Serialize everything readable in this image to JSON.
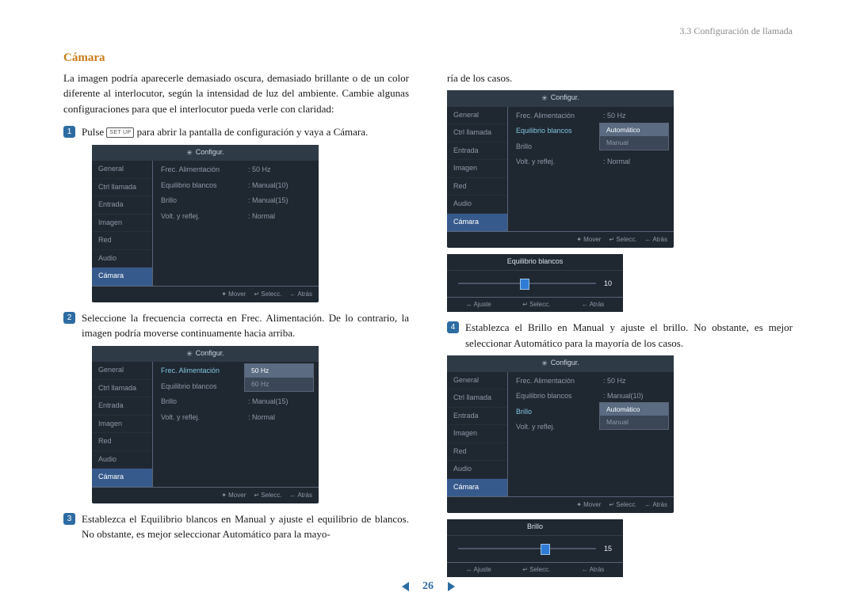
{
  "breadcrumb": "3.3 Configuración de llamada",
  "heading": "Cámara",
  "intro": "La imagen podría aparecerle demasiado oscura, demasiado brillante o de un color diferente al interlocutor, según la intensidad de luz del ambiente. Cambie algunas configuraciones para que el interlocutor pueda verle con claridad:",
  "step1_pre": "Pulse ",
  "setup_key": "SET UP",
  "step1_post": " para abrir la pantalla de configuración y vaya a Cámara.",
  "step2": "Seleccione la frecuencia correcta en Frec. Alimentación. De lo contrario, la imagen podría moverse continuamente hacia arriba.",
  "step3": "Establezca el Equilibrio blancos en Manual y ajuste el equilibrio de blancos. No obstante, es mejor seleccionar Automático para la mayo-",
  "col2_cont": "ría de los casos.",
  "step4": "Establezca el Brillo en Manual y ajuste el brillo. No obstante, es mejor seleccionar Automático para la mayoría de los casos.",
  "panel_title": "Configur.",
  "sidebar_items": [
    "General",
    "Ctrl llamada",
    "Entrada",
    "Imagen",
    "Red",
    "Audio",
    "Cámara"
  ],
  "rows_frec": {
    "lab": "Frec. Alimentación",
    "val": ": 50 Hz"
  },
  "rows_eq": "Equilibrio blancos",
  "rows_brillo": "Brillo",
  "rows_volt": "Volt. y reflej.",
  "val_manual10": ": Manual(10)",
  "val_manual15": ": Manual(15)",
  "val_normal": ": Normal",
  "opt_50": "50 Hz",
  "opt_60": "60 Hz",
  "opt_auto": "Automático",
  "opt_manual": "Manual",
  "footer_mover": "✦ Mover",
  "footer_selec": "↵ Selecc.",
  "footer_atras": "← Atrás",
  "slider_eq_title": "Equilibrio blancos",
  "slider_eq_value": "10",
  "slider_brillo_title": "Brillo",
  "slider_brillo_value": "15",
  "slider_ajuste": "↔ Ajuste",
  "page_number": "26"
}
